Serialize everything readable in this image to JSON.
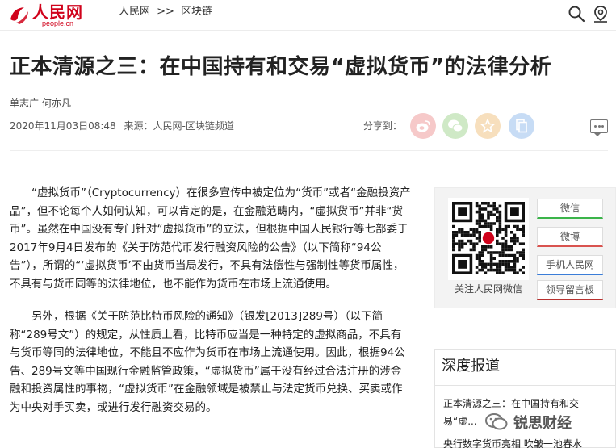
{
  "header": {
    "logo_text": "人民网",
    "logo_url": "people.cn",
    "breadcrumb": [
      "人民网",
      ">>",
      "区块链"
    ]
  },
  "article": {
    "title": "正本清源之三：在中国持有和交易“虚拟货币”的法律分析",
    "authors": "单志广 何亦凡",
    "date": "2020年11月03日08:48",
    "source": "来源：人民网-区块链频道",
    "share_label": "分享到：",
    "paragraphs": [
      "“虚拟货币”（Cryptocurrency）在很多宣传中被定位为“货币”或者“金融投资产品”，但不论每个人如何认知，可以肯定的是，在金融范畴内，“虚拟货币”并非“货币”。虽然在中国没有专门针对“虚拟货币”的立法，但根据中国人民银行等七部委于2017年9月4日发布的《关于防范代币发行融资风险的公告》（以下简称“94公告”），所谓的“‘虚拟货币’不由货币当局发行，不具有法偿性与强制性等货币属性，不具有与货币同等的法律地位，也不能作为货币在市场上流通使用。",
      "另外，根据《关于防范比特币风险的通知》（银发[2013]289号）（以下简称“289号文”）的规定，从性质上看，比特币应当是一种特定的虚拟商品，不具有与货币等同的法律地位，不能且不应作为货币在市场上流通使用。因此，根据94公告、289号文等中国现行金融监管政策，“虚拟货币”属于没有经过合法注册的涉金融和投资属性的事物，“虚拟货币”在金融领域是被禁止与法定货币兑换、买卖或作为中央对手买卖，或进行发行融资交易的。"
    ]
  },
  "sidebar": {
    "qr_label": "关注人民网微信",
    "buttons": [
      "微信",
      "微博",
      "手机人民网",
      "领导留言板"
    ],
    "deep_title": "深度报道",
    "deep_items": [
      "正本清源之三：在中国持有和交易“虚...",
      "央行数字货币亮相 吹皱一池春水"
    ]
  },
  "watermark": "锐思财经",
  "colors": {
    "brand_red": "#d0021b",
    "wechat_green": "#3bb44a",
    "weibo_red": "#d9534f",
    "mobile_blue": "#3b7dd8"
  },
  "icons": {
    "search": "search-icon",
    "location": "location-icon",
    "weibo": "weibo-icon",
    "wechat": "wechat-icon",
    "favorite": "star-icon",
    "copy": "copy-icon",
    "comment": "comment-icon"
  }
}
